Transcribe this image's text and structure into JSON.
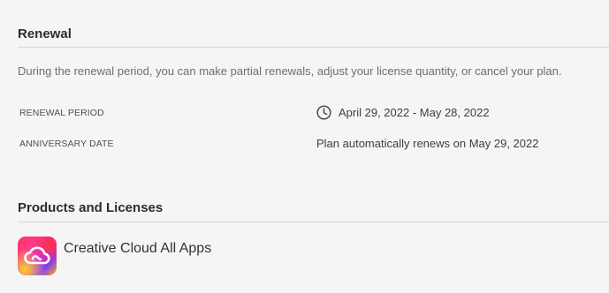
{
  "renewal": {
    "title": "Renewal",
    "description": "During the renewal period, you can make partial renewals, adjust your license quantity, or cancel your plan.",
    "period_label": "RENEWAL PERIOD",
    "period_value": "April 29, 2022 - May 28, 2022",
    "period_icon": "clock-icon",
    "anniversary_label": "ANNIVERSARY DATE",
    "anniversary_value": "Plan automatically renews on May 29, 2022"
  },
  "products": {
    "title": "Products and Licenses",
    "items": [
      {
        "name": "Creative Cloud All Apps",
        "icon": "creative-cloud-icon"
      }
    ]
  }
}
